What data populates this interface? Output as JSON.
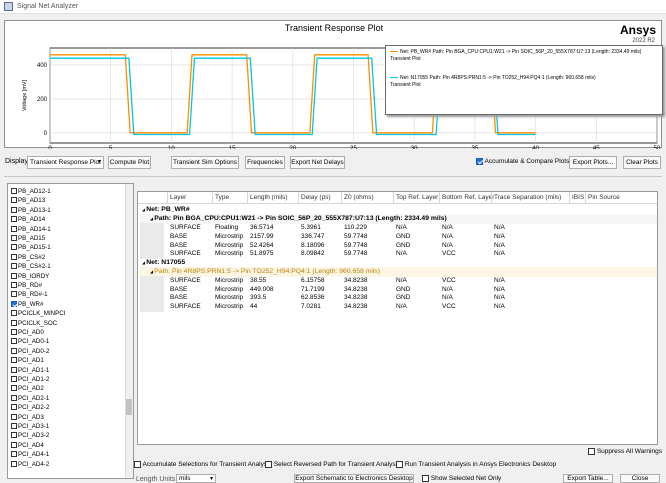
{
  "window": {
    "title": "Signal Net Analyzer"
  },
  "plot": {
    "title": "Transient Response Plot",
    "brand": "Ansys",
    "version": "2022 R2",
    "ylabel": "Voltage [mV]",
    "xlabel": "Time [ns]"
  },
  "chart_data": {
    "type": "line",
    "title": "Transient Response Plot",
    "xlabel": "Time [ns]",
    "ylabel": "Voltage [mV]",
    "xlim": [
      0,
      50
    ],
    "ylim": [
      -60,
      500
    ],
    "xticks": [
      0,
      5,
      10,
      15,
      20,
      25,
      30,
      35,
      40,
      45,
      50
    ],
    "yticks": [
      0,
      200,
      400
    ],
    "grid": true,
    "legend_position": "top-right",
    "series": [
      {
        "name": "Net: PB_WR#   Path: Pin BGA_CPU:CPU1:W21 -> Pin SOIC_56P_20_555X787:U7:13 (Length: 2334.49 mils)",
        "subtitle": "Transient Plot",
        "color": "#ff8c00",
        "x": [
          0,
          6.2,
          6.6,
          11.3,
          11.7,
          16.2,
          16.6,
          21.4,
          21.8,
          26.2,
          26.6,
          31.5,
          31.9,
          36.3,
          36.7,
          40
        ],
        "y": [
          460,
          460,
          0,
          0,
          460,
          460,
          0,
          0,
          460,
          460,
          0,
          0,
          460,
          460,
          0,
          0
        ]
      },
      {
        "name": "Net: N17055   Path: Pin 4R8PS:PRN1:5 -> Pin TO252_H94:PQ4:1 (Length: 960.658 mils)",
        "subtitle": "Transient Plot",
        "color": "#00c8e0",
        "x": [
          0,
          6.5,
          6.9,
          11.5,
          11.9,
          16.5,
          16.9,
          21.6,
          22.0,
          26.5,
          26.9,
          31.8,
          32.2,
          36.5,
          36.9,
          40
        ],
        "y": [
          440,
          440,
          -10,
          -10,
          440,
          440,
          -10,
          -10,
          440,
          440,
          -10,
          -10,
          440,
          440,
          -10,
          -10
        ]
      }
    ]
  },
  "toolbar": {
    "display_label": "Display",
    "display_value": "Transient Response Plot",
    "compute_plot": "Compute Plot",
    "transient_sim_options": "Transient Sim Options",
    "frequencies": "Frequencies",
    "export_net_delays": "Export Net Delays",
    "accumulate_compare": "Accumulate & Compare Plots",
    "export_plots": "Export Plots...",
    "clear_plots": "Clear Plots"
  },
  "nets": [
    {
      "name": "PB_AD12-1",
      "checked": false
    },
    {
      "name": "PB_AD13",
      "checked": false
    },
    {
      "name": "PB_AD13-1",
      "checked": false
    },
    {
      "name": "PB_AD14",
      "checked": false
    },
    {
      "name": "PB_AD14-1",
      "checked": false
    },
    {
      "name": "PB_AD15",
      "checked": false
    },
    {
      "name": "PB_AD15-1",
      "checked": false
    },
    {
      "name": "PB_CS#2",
      "checked": false
    },
    {
      "name": "PB_CS#2-1",
      "checked": false
    },
    {
      "name": "PB_IORDY",
      "checked": false
    },
    {
      "name": "PB_RD#",
      "checked": false
    },
    {
      "name": "PB_RD#-1",
      "checked": false
    },
    {
      "name": "PB_WR#",
      "checked": true
    },
    {
      "name": "PCICLK_MINPCI",
      "checked": false
    },
    {
      "name": "PCICLK_SOC",
      "checked": false
    },
    {
      "name": "PCI_AD0",
      "checked": false
    },
    {
      "name": "PCI_AD0-1",
      "checked": false
    },
    {
      "name": "PCI_AD0-2",
      "checked": false
    },
    {
      "name": "PCI_AD1",
      "checked": false
    },
    {
      "name": "PCI_AD1-1",
      "checked": false
    },
    {
      "name": "PCI_AD1-2",
      "checked": false
    },
    {
      "name": "PCI_AD2",
      "checked": false
    },
    {
      "name": "PCI_AD2-1",
      "checked": false
    },
    {
      "name": "PCI_AD2-2",
      "checked": false
    },
    {
      "name": "PCI_AD3",
      "checked": false
    },
    {
      "name": "PCI_AD3-1",
      "checked": false
    },
    {
      "name": "PCI_AD3-2",
      "checked": false
    },
    {
      "name": "PCI_AD4",
      "checked": false
    },
    {
      "name": "PCI_AD4-1",
      "checked": false
    },
    {
      "name": "PCI_AD4-2",
      "checked": false
    }
  ],
  "table": {
    "headers": [
      "Layer",
      "Type",
      "Length (mils)",
      "Delay (ps)",
      "Z0 (ohms)",
      "Top Ref. Layer",
      "Bottom Ref. Layer",
      "Trace Separation (mils)",
      "IBIS",
      "Pin Source"
    ],
    "groups": [
      {
        "net": "Net: PB_WR#",
        "path": "Path: Pin BGA_CPU:CPU1:W21 -> Pin SOIC_56P_20_555X787:U7:13 (Length: 2334.49 mils)",
        "path_color": "#000000",
        "rows": [
          [
            "SURFACE",
            "Floating",
            "36.5714",
            "5.3961",
            "110.229",
            "N/A",
            "N/A",
            "N/A"
          ],
          [
            "BASE",
            "Microstrip",
            "2157.99",
            "336.747",
            "59.7748",
            "GND",
            "N/A",
            "N/A"
          ],
          [
            "BASE",
            "Microstrip",
            "52.4264",
            "8.18096",
            "59.7748",
            "GND",
            "N/A",
            "N/A"
          ],
          [
            "SURFACE",
            "Microstrip",
            "51.8975",
            "8.09842",
            "59.7748",
            "N/A",
            "VCC",
            "N/A"
          ]
        ]
      },
      {
        "net": "Net: N17055",
        "path": "Path: Pin 4R8PS:PRN1:5 -> Pin TO252_H94:PQ4:1 (Length: 960.658 mils)",
        "path_color": "#c08000",
        "rows": [
          [
            "SURFACE",
            "Microstrip",
            "38.55",
            "6.15758",
            "34.8238",
            "N/A",
            "VCC",
            "N/A"
          ],
          [
            "BASE",
            "Microstrip",
            "449.008",
            "71.7199",
            "34.8238",
            "GND",
            "N/A",
            "N/A"
          ],
          [
            "BASE",
            "Microstrip",
            "393.5",
            "62.8536",
            "34.8238",
            "GND",
            "N/A",
            "N/A"
          ],
          [
            "SURFACE",
            "Microstrip",
            "44",
            "7.0281",
            "34.8238",
            "N/A",
            "VCC",
            "N/A"
          ]
        ]
      }
    ]
  },
  "bottom": {
    "suppress_warnings": "Suppress All Warnings",
    "accumulate_selections": "Accumulate Selections for Transient Analysis",
    "select_reversed": "Select Reversed Path for Transient Analysis",
    "run_transient": "Run Transient Analysis in Ansys Electronics Desktop",
    "length_units": "Length Units",
    "length_units_value": "mils",
    "export_schematic": "Export Schematic to Electronics Desktop",
    "show_selected_net_only": "Show Selected Net Only",
    "export_table": "Export Table...",
    "close": "Close"
  }
}
